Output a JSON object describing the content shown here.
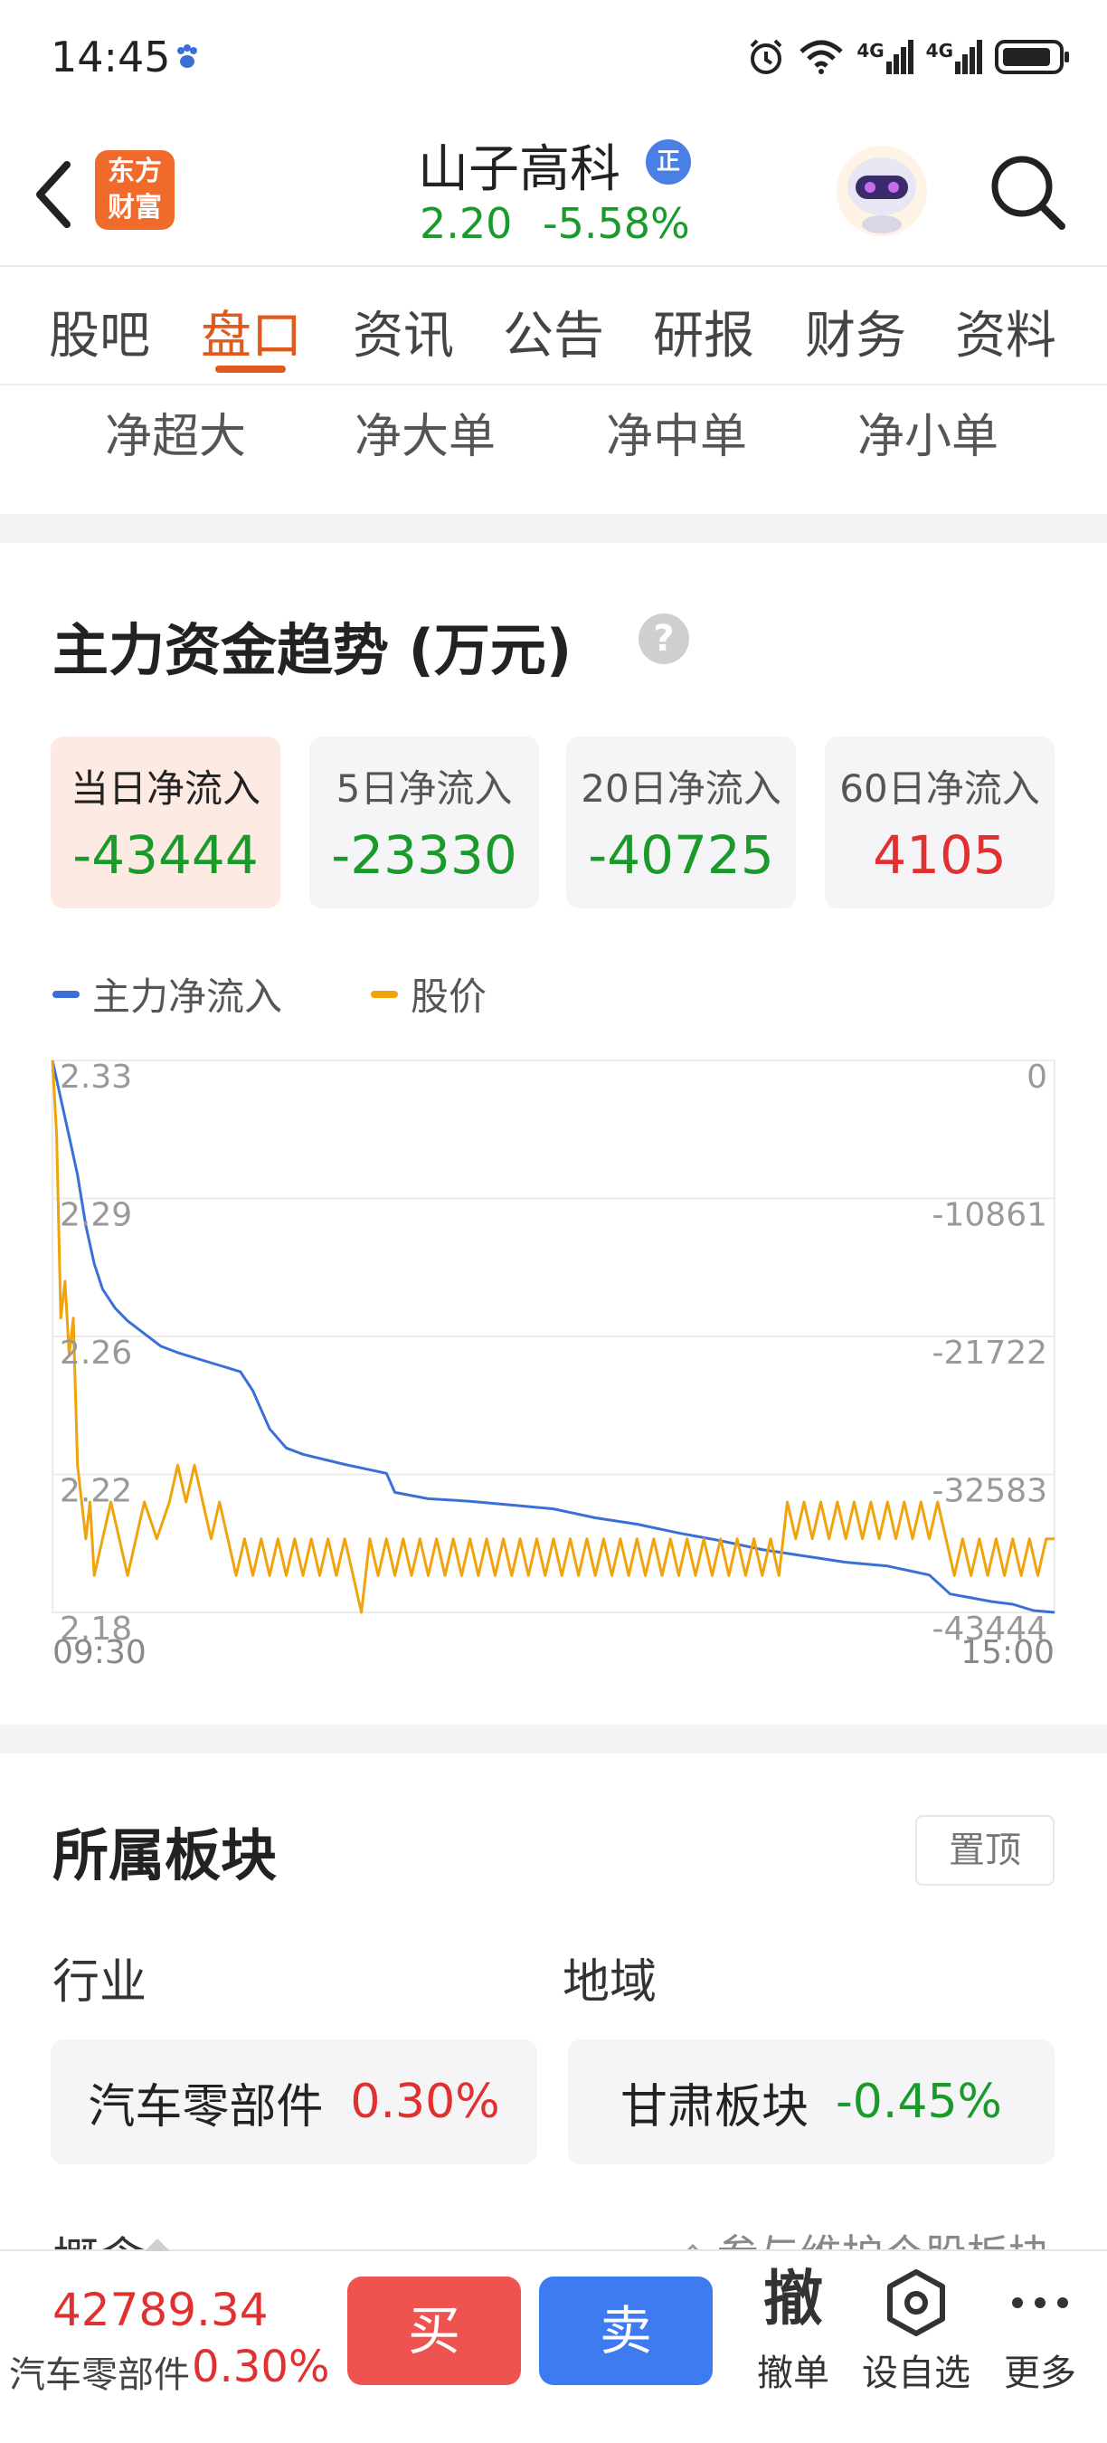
{
  "status_bar": {
    "time": "14:45",
    "signal_labels": [
      "4G",
      "4G"
    ],
    "icons": [
      "paw-icon",
      "alarm-icon",
      "wifi-icon",
      "signal-icon",
      "signal-icon",
      "battery-icon"
    ]
  },
  "header": {
    "logo_text": "东方\n财富",
    "stock_name": "山子高科",
    "badge": "正",
    "price": "2.20",
    "change": "-5.58%"
  },
  "tabs": [
    "股吧",
    "盘口",
    "资讯",
    "公告",
    "研报",
    "财务",
    "资料"
  ],
  "active_tab": "盘口",
  "subtabs": [
    "净超大",
    "净大单",
    "净中单",
    "净小单"
  ],
  "fund_trend": {
    "title": "主力资金趋势 (万元)",
    "help": "?",
    "cards": [
      {
        "label": "当日净流入",
        "value": "-43444"
      },
      {
        "label": "5日净流入",
        "value": "-23330"
      },
      {
        "label": "20日净流入",
        "value": "-40725"
      },
      {
        "label": "60日净流入",
        "value": "4105"
      }
    ],
    "legend": [
      {
        "name": "主力净流入",
        "color": "#3b6fd8"
      },
      {
        "name": "股价",
        "color": "#f0a30a"
      }
    ]
  },
  "chart_data": {
    "type": "line",
    "x_start": "09:30",
    "x_end": "15:00",
    "x_range_minutes": [
      0,
      240
    ],
    "y_left_ticks": [
      "2.33",
      "2.29",
      "2.26",
      "2.22",
      "2.18"
    ],
    "y_left_range": [
      2.18,
      2.33
    ],
    "y_right_ticks": [
      "0",
      "-10861",
      "-21722",
      "-32583",
      "-43444"
    ],
    "y_right_range": [
      -43444,
      0
    ],
    "grid": true,
    "series": [
      {
        "name": "主力净流入",
        "axis": "right",
        "color": "#3b6fd8",
        "x": [
          0,
          2,
          4,
          6,
          8,
          10,
          12,
          15,
          18,
          22,
          26,
          30,
          35,
          40,
          45,
          48,
          52,
          56,
          60,
          70,
          80,
          82,
          90,
          100,
          110,
          120,
          130,
          140,
          150,
          160,
          170,
          180,
          190,
          200,
          210,
          215,
          220,
          225,
          230,
          235,
          240
        ],
        "values": [
          0,
          -3000,
          -6000,
          -9000,
          -13000,
          -16000,
          -18000,
          -19500,
          -20500,
          -21500,
          -22500,
          -23000,
          -23500,
          -24000,
          -24500,
          -26000,
          -29000,
          -30500,
          -31000,
          -31800,
          -32500,
          -34000,
          -34500,
          -34700,
          -35000,
          -35300,
          -36000,
          -36500,
          -37200,
          -37800,
          -38500,
          -39000,
          -39500,
          -39800,
          -40500,
          -42000,
          -42300,
          -42600,
          -42800,
          -43300,
          -43444
        ]
      },
      {
        "name": "股价",
        "axis": "left",
        "color": "#f0a30a",
        "x": [
          0,
          1,
          2,
          3,
          4,
          5,
          6,
          7,
          8,
          9,
          10,
          12,
          14,
          16,
          18,
          20,
          22,
          25,
          28,
          30,
          32,
          34,
          36,
          38,
          40,
          42,
          44,
          46,
          48,
          50,
          52,
          54,
          56,
          58,
          60,
          62,
          64,
          66,
          68,
          70,
          72,
          74,
          76,
          78,
          80,
          82,
          84,
          86,
          88,
          90,
          92,
          94,
          96,
          98,
          100,
          102,
          104,
          106,
          108,
          110,
          112,
          114,
          116,
          118,
          120,
          122,
          124,
          126,
          128,
          130,
          132,
          134,
          136,
          138,
          140,
          142,
          144,
          146,
          148,
          150,
          152,
          154,
          156,
          158,
          160,
          162,
          164,
          166,
          168,
          170,
          172,
          174,
          176,
          178,
          180,
          182,
          184,
          186,
          188,
          190,
          192,
          194,
          196,
          198,
          200,
          202,
          204,
          206,
          208,
          210,
          212,
          214,
          216,
          218,
          220,
          222,
          224,
          226,
          228,
          230,
          232,
          234,
          236,
          238,
          240
        ],
        "values": [
          2.33,
          2.31,
          2.26,
          2.27,
          2.25,
          2.26,
          2.22,
          2.21,
          2.2,
          2.21,
          2.19,
          2.2,
          2.21,
          2.2,
          2.19,
          2.2,
          2.21,
          2.2,
          2.21,
          2.22,
          2.21,
          2.22,
          2.21,
          2.2,
          2.21,
          2.2,
          2.19,
          2.2,
          2.19,
          2.2,
          2.19,
          2.2,
          2.19,
          2.2,
          2.19,
          2.2,
          2.19,
          2.2,
          2.19,
          2.2,
          2.19,
          2.18,
          2.2,
          2.19,
          2.2,
          2.19,
          2.2,
          2.19,
          2.2,
          2.19,
          2.2,
          2.19,
          2.2,
          2.19,
          2.2,
          2.19,
          2.2,
          2.19,
          2.2,
          2.19,
          2.2,
          2.19,
          2.2,
          2.19,
          2.2,
          2.19,
          2.2,
          2.19,
          2.2,
          2.19,
          2.2,
          2.19,
          2.2,
          2.19,
          2.2,
          2.19,
          2.2,
          2.19,
          2.2,
          2.19,
          2.2,
          2.19,
          2.2,
          2.19,
          2.2,
          2.19,
          2.2,
          2.19,
          2.2,
          2.19,
          2.2,
          2.19,
          2.21,
          2.2,
          2.21,
          2.2,
          2.21,
          2.2,
          2.21,
          2.2,
          2.21,
          2.2,
          2.21,
          2.2,
          2.21,
          2.2,
          2.21,
          2.2,
          2.21,
          2.2,
          2.21,
          2.2,
          2.19,
          2.2,
          2.19,
          2.2,
          2.19,
          2.2,
          2.19,
          2.2,
          2.19,
          2.2,
          2.19,
          2.2,
          2.2
        ]
      }
    ]
  },
  "sector": {
    "title": "所属板块",
    "pin_label": "置顶",
    "industry_label": "行业",
    "region_label": "地域",
    "industry": {
      "name": "汽车零部件",
      "pct": "0.30%"
    },
    "region": {
      "name": "甘肃板块",
      "pct": "-0.45%"
    },
    "concept_label": "概念",
    "concept_link": "参与维护个股板块"
  },
  "bottom_bar": {
    "index_value": "42789.34",
    "sector_name": "汽车零部件",
    "sector_pct": "0.30%",
    "buy": "买",
    "sell": "卖",
    "cancel_glyph": "撤",
    "cancel_label": "撤单",
    "watch_label": "设自选",
    "more_label": "更多"
  },
  "colors": {
    "accent": "#e05a1e",
    "up": "#e0302f",
    "down": "#1a9a2a"
  }
}
